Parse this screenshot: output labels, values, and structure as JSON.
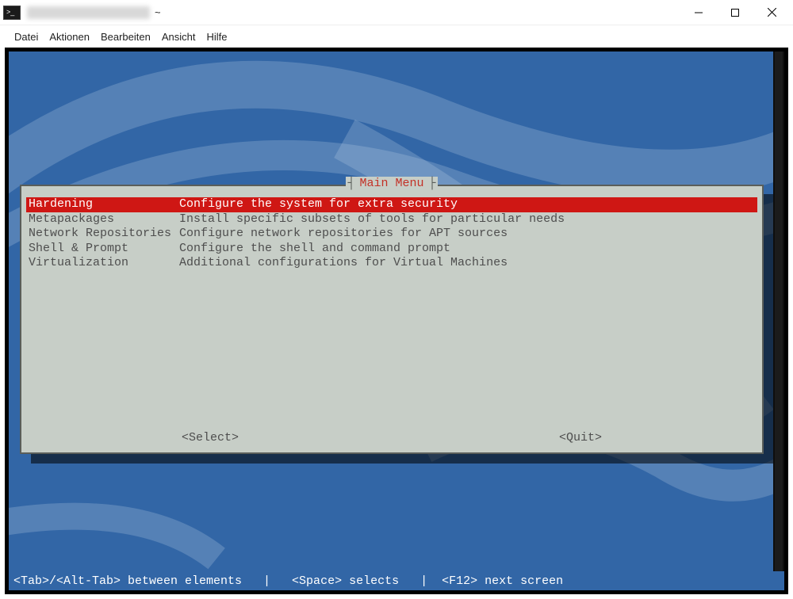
{
  "window": {
    "title_suffix": "~",
    "menus": [
      "Datei",
      "Aktionen",
      "Bearbeiten",
      "Ansicht",
      "Hilfe"
    ]
  },
  "colors": {
    "term_bg": "#3266a6",
    "dialog_bg": "#c7cec7",
    "dialog_border": "#5a5e5a",
    "title_fg": "#c33126",
    "highlight_bg": "#cf1714",
    "text": "#4e4e4e"
  },
  "dialog": {
    "title": "Main Menu",
    "items": [
      {
        "label": "Hardening",
        "desc": "Configure the system for extra security",
        "selected": true
      },
      {
        "label": "Metapackages",
        "desc": "Install specific subsets of tools for particular needs",
        "selected": false
      },
      {
        "label": "Network Repositories",
        "desc": "Configure network repositories for APT sources",
        "selected": false
      },
      {
        "label": "Shell & Prompt",
        "desc": "Configure the shell and command prompt",
        "selected": false
      },
      {
        "label": "Virtualization",
        "desc": "Additional configurations for Virtual Machines",
        "selected": false
      }
    ],
    "buttons": {
      "select": "<Select>",
      "quit": "<Quit>"
    }
  },
  "hints": {
    "text": "<Tab>/<Alt-Tab> between elements   |   <Space> selects   |  <F12> next screen"
  }
}
